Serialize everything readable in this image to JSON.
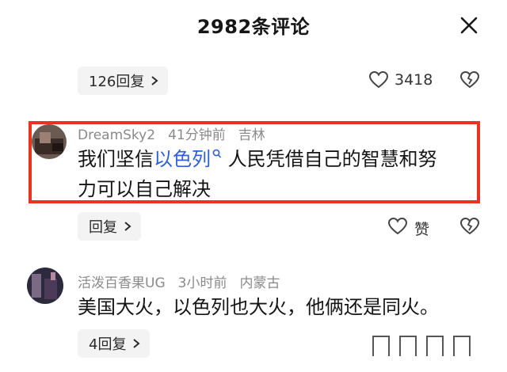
{
  "header": {
    "title": "2982条评论"
  },
  "thread_top": {
    "replies_label": "126回复",
    "like_count": "3418"
  },
  "comment1": {
    "username": "DreamSky2",
    "time": "41分钟前",
    "location": "吉林",
    "text_before": "我们坚信",
    "link_text": "以色列",
    "text_line1_after": " 人民凭借自己的智慧和努",
    "text_line2": "力可以自己解决",
    "reply_label": "回复",
    "like_label": "赞"
  },
  "comment2": {
    "username": "活泼百香果UG",
    "time": "3小时前",
    "location": "内蒙古",
    "text": "美国大火，以色列也大火，他俩还是同火。",
    "replies_label": "4回复"
  },
  "colors": {
    "highlight_border": "#e8331f",
    "link": "#2f5fd6"
  }
}
